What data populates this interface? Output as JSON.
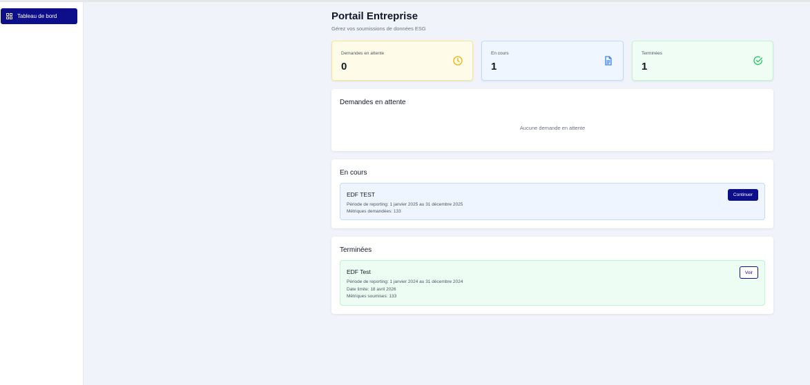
{
  "sidebar": {
    "items": [
      {
        "label": "Tableau de bord",
        "icon": "dashboard-grid-icon"
      }
    ]
  },
  "header": {
    "title": "Portail Entreprise",
    "subtitle": "Gérez vos soumissions de données ESG"
  },
  "stats": {
    "pending": {
      "label": "Demandes en attente",
      "value": "0",
      "icon": "clock-icon",
      "color": "#eab308"
    },
    "in_progress": {
      "label": "En cours",
      "value": "1",
      "icon": "document-icon",
      "color": "#3b82f6"
    },
    "completed": {
      "label": "Terminées",
      "value": "1",
      "icon": "check-circle-icon",
      "color": "#22c55e"
    }
  },
  "sections": {
    "pending": {
      "title": "Demandes en attente",
      "empty_text": "Aucune demande en attente"
    },
    "in_progress": {
      "title": "En cours",
      "items": [
        {
          "name": "EDF TEST",
          "period": "Période de reporting: 1 janvier 2025 au 31 décembre 2025",
          "metrics": "Métriques demandées: 133",
          "action": "Continuer"
        }
      ]
    },
    "completed": {
      "title": "Terminées",
      "items": [
        {
          "name": "EDF Test",
          "period": "Période de reporting: 1 janvier 2024 au 31 décembre 2024",
          "deadline": "Date limite: 18 avril 2026",
          "metrics": "Métriques soumises: 133",
          "action": "Voir"
        }
      ]
    }
  },
  "colors": {
    "accent": "#0d0e8a",
    "background": "#f1f3fb"
  }
}
